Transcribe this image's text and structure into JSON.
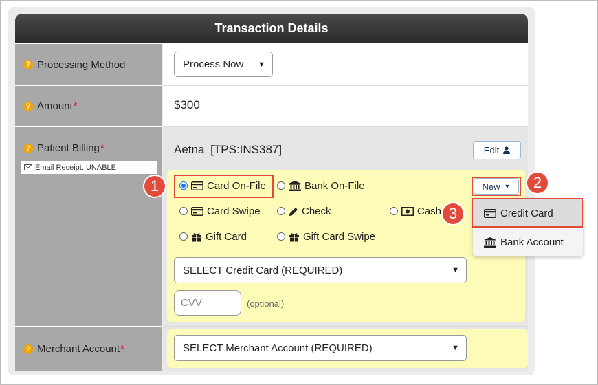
{
  "header": {
    "title": "Transaction Details"
  },
  "processing": {
    "label": "Processing Method",
    "selected": "Process Now"
  },
  "amount": {
    "label": "Amount",
    "value": "$300"
  },
  "billing": {
    "label": "Patient Billing",
    "email_receipt": "Email Receipt: UNABLE",
    "insurer": "Aetna",
    "code": "[TPS:INS387]",
    "edit_label": "Edit"
  },
  "payment_options": {
    "card_on_file": "Card On-File",
    "bank_on_file": "Bank On-File",
    "card_swipe": "Card Swipe",
    "check": "Check",
    "cash": "Cash",
    "gift_card": "Gift Card",
    "gift_card_swipe": "Gift Card Swipe",
    "selected": "Card On-File"
  },
  "new_menu": {
    "button_label": "New",
    "items": [
      "Credit Card",
      "Bank Account"
    ],
    "highlighted": "Credit Card"
  },
  "credit_card_select": {
    "selected": "SELECT Credit Card (REQUIRED)"
  },
  "cvv": {
    "placeholder": "CVV",
    "hint": "(optional)"
  },
  "merchant": {
    "label": "Merchant Account",
    "selected": "SELECT Merchant Account (REQUIRED)"
  },
  "callouts": [
    "1",
    "2",
    "3"
  ],
  "colors": {
    "header": "#2b2b2b",
    "label_bg": "#a8a8a8",
    "option_bg": "#fdfbb8",
    "callout": "#e24a3b",
    "required": "#d9001b",
    "help_icon": "#f0a500"
  },
  "icons": [
    "help-icon",
    "credit-card-icon",
    "bank-icon",
    "pencil-icon",
    "money-icon",
    "gift-icon",
    "user-icon",
    "envelope-icon",
    "chevron-down-icon"
  ]
}
